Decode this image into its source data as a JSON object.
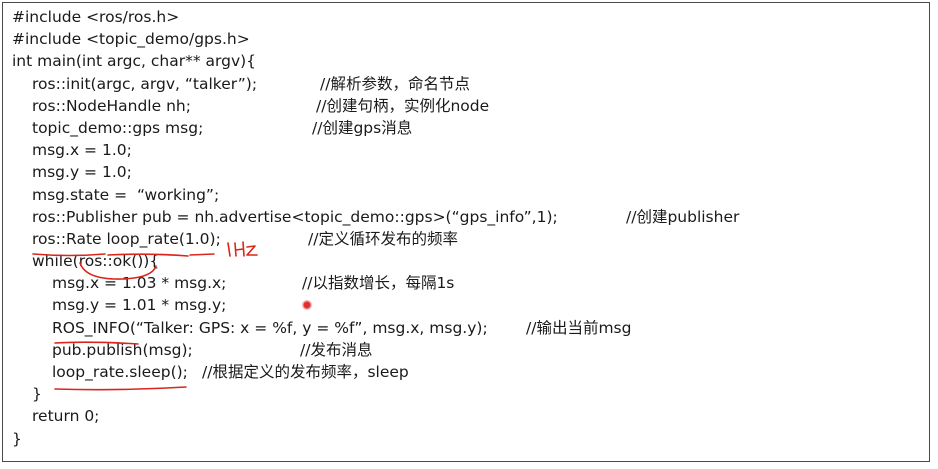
{
  "code_lines": [
    {
      "code": "#include <ros/ros.h>",
      "comment": ""
    },
    {
      "code": "#include <topic_demo/gps.h>",
      "comment": ""
    },
    {
      "code": "int main(int argc, char** argv){",
      "comment": ""
    },
    {
      "code": "ros::init(argc, argv, “talker”);",
      "comment": "//解析参数，命名节点"
    },
    {
      "code": "ros::NodeHandle nh;",
      "comment": "//创建句柄，实例化node"
    },
    {
      "code": "topic_demo::gps msg;",
      "comment": "//创建gps消息"
    },
    {
      "code": "msg.x = 1.0;",
      "comment": ""
    },
    {
      "code": "msg.y = 1.0;",
      "comment": ""
    },
    {
      "code": "msg.state =  “working”;",
      "comment": ""
    },
    {
      "code": "ros::Publisher pub = nh.advertise<topic_demo::gps>(“gps_info”,1);",
      "comment": "//创建publisher"
    },
    {
      "code": "ros::Rate loop_rate(1.0);",
      "comment": "//定义循环发布的频率"
    },
    {
      "code": "while(ros::ok()){",
      "comment": ""
    },
    {
      "code": "msg.x = 1.03 * msg.x;",
      "comment": "//以指数增长，每隔1s"
    },
    {
      "code": "msg.y = 1.01 * msg.y;",
      "comment": ""
    },
    {
      "code": "ROS_INFO(“Talker: GPS: x = %f, y = %f”, msg.x, msg.y);",
      "comment": "//输出当前msg"
    },
    {
      "code": "pub.publish(msg);",
      "comment": "//发布消息"
    },
    {
      "code": "loop_rate.sleep();",
      "comment": "//根据定义的发布频率，sleep"
    },
    {
      "code": "}",
      "comment": ""
    },
    {
      "code": "return 0;",
      "comment": ""
    },
    {
      "code": "}",
      "comment": ""
    }
  ],
  "handwritten_note": "1Hz",
  "annotation_color": "#d9261c"
}
